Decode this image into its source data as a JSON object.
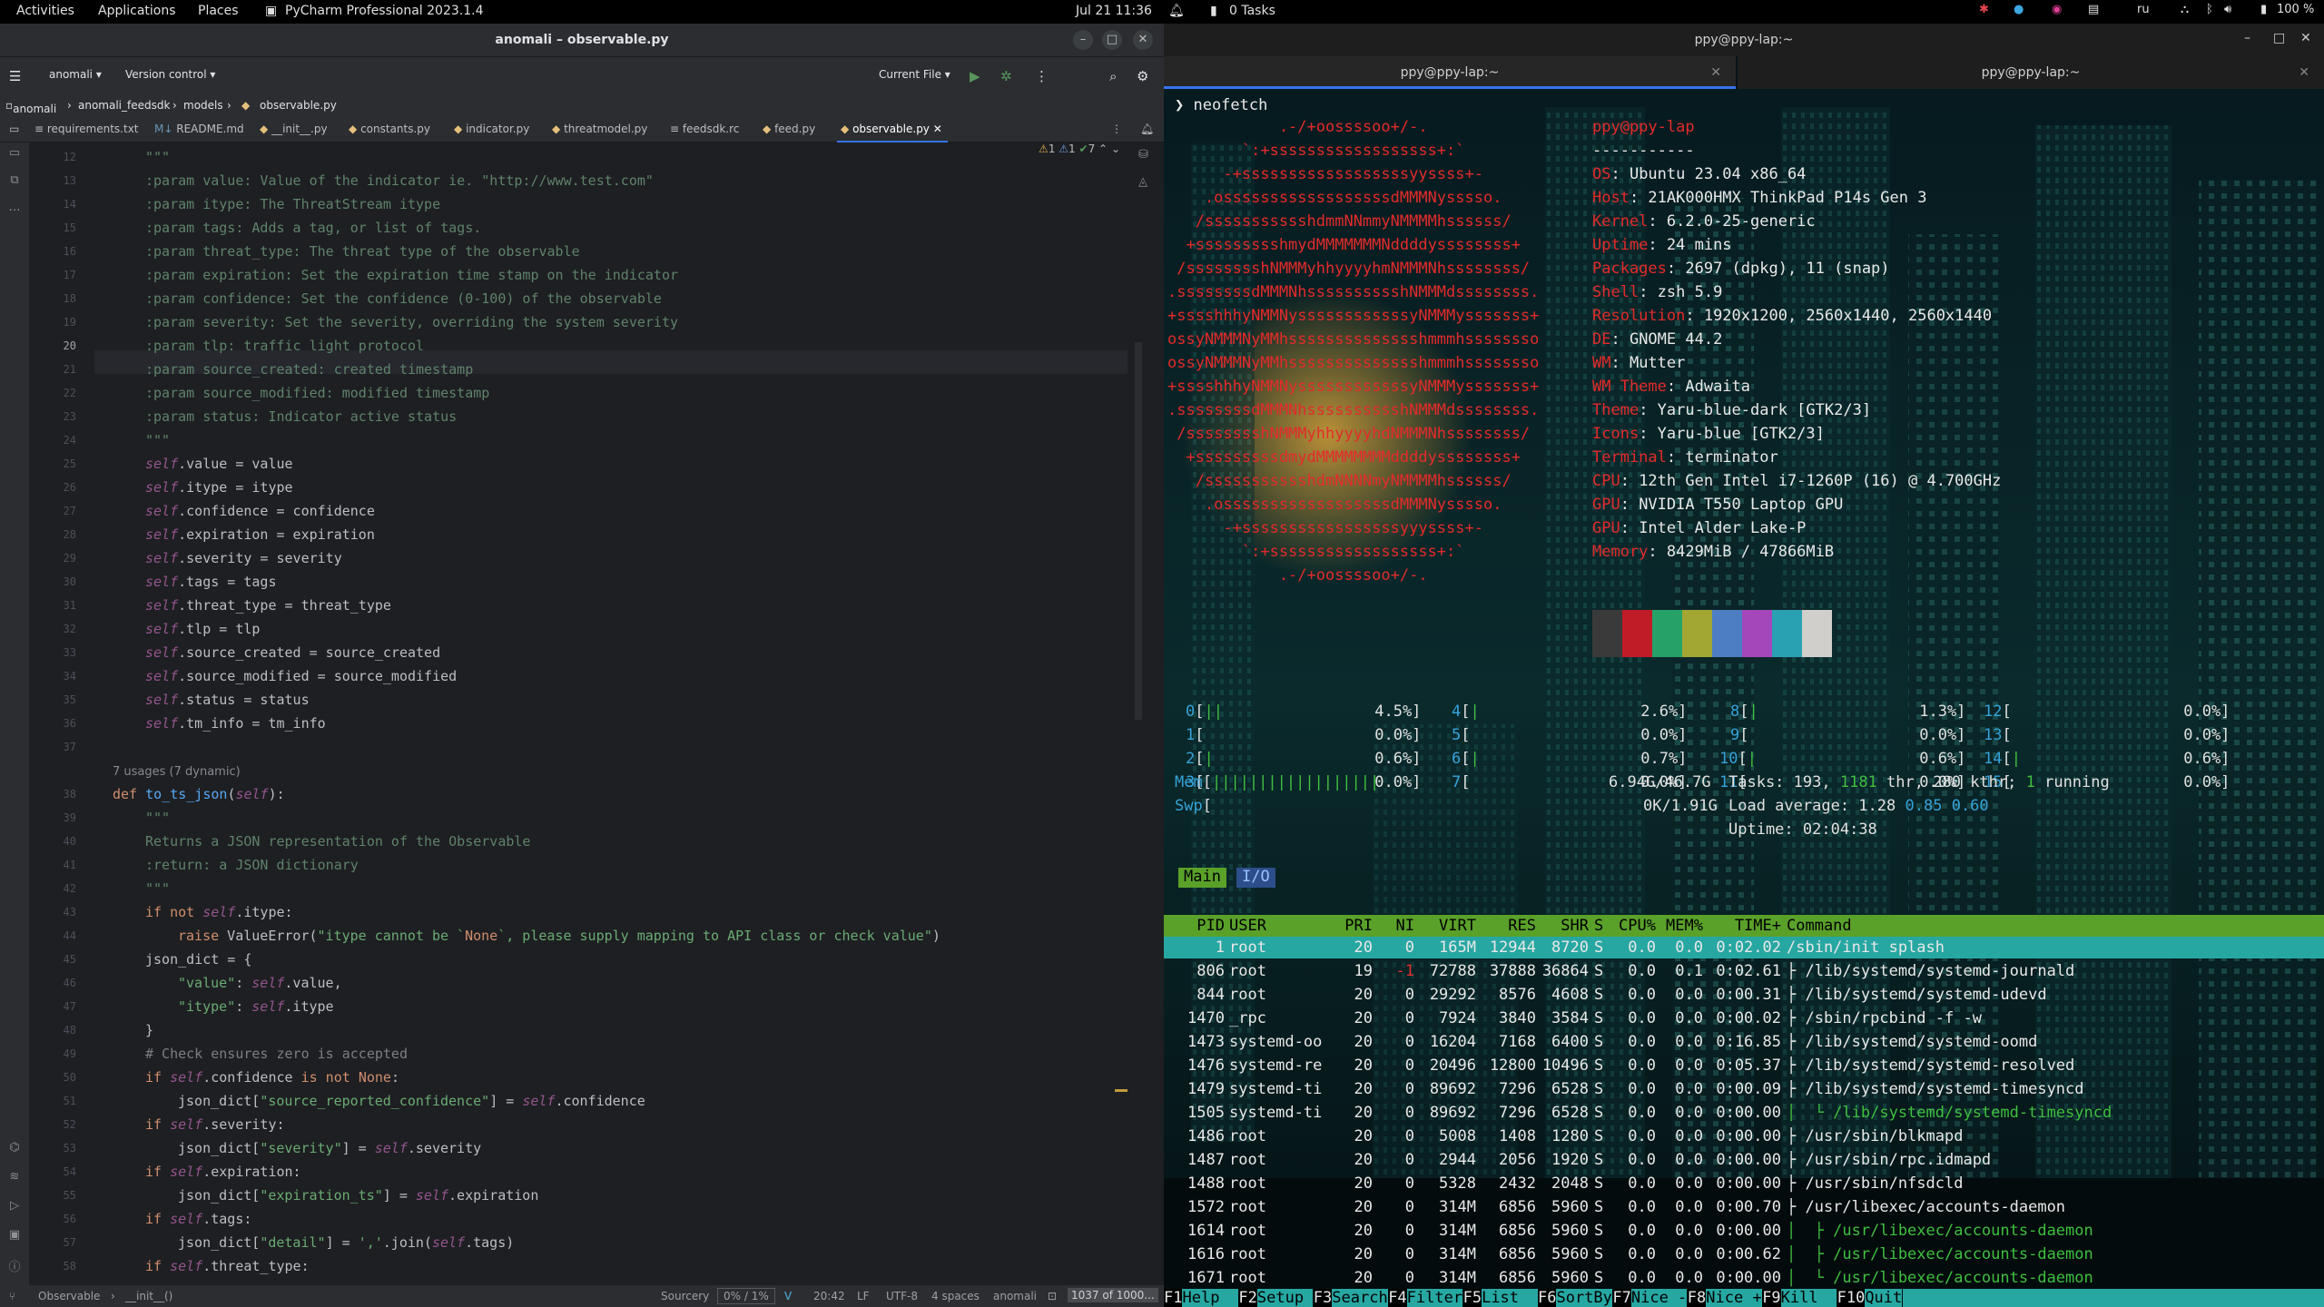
{
  "topbar": {
    "activities": "Activities",
    "applications": "Applications",
    "places": "Places",
    "window_app": "PyCharm Professional 2023.1.4",
    "datetime": "Jul 21  11:36",
    "tasks": "0 Tasks",
    "lang": "ru",
    "battery": "100 %"
  },
  "ide": {
    "title": "anomali – observable.py",
    "project": "anomali",
    "vcs": "Version control",
    "run_config": "Current File",
    "breadcrumb": [
      "anomali",
      "anomali_feedsdk",
      "models",
      "observable.py"
    ],
    "tabs": [
      "requirements.txt",
      "README.md",
      "__init__.py",
      "constants.py",
      "indicator.py",
      "threatmodel.py",
      "feedsdk.rc",
      "feed.py",
      "observable.py"
    ],
    "inspections": {
      "warn": "1",
      "weak": "1",
      "ok": "7"
    },
    "line_numbers": [
      "12",
      "13",
      "14",
      "15",
      "16",
      "17",
      "18",
      "19",
      "20",
      "21",
      "22",
      "23",
      "24",
      "25",
      "26",
      "27",
      "28",
      "29",
      "30",
      "31",
      "32",
      "33",
      "34",
      "35",
      "36",
      "37",
      "",
      "38",
      "39",
      "40",
      "41",
      "42",
      "43",
      "44",
      "45",
      "46",
      "47",
      "48",
      "49",
      "50",
      "51",
      "52",
      "53",
      "54",
      "55",
      "56",
      "57",
      "58"
    ],
    "current_line": "20",
    "code": [
      "\"\"\"",
      ":param value: Value of the indicator ie. \"http://www.test.com\"",
      ":param itype: The ThreatStream itype",
      ":param tags: Adds a tag, or list of tags.",
      ":param threat_type: The threat type of the observable",
      ":param expiration: Set the expiration time stamp on the indicator",
      ":param confidence: Set the confidence (0-100) of the observable",
      ":param severity: Set the severity, overriding the system severity",
      ":param tlp: traffic light protocol",
      ":param source_created: created timestamp",
      ":param source_modified: modified timestamp",
      ":param status: Indicator active status",
      "\"\"\"",
      "self.value = value",
      "self.itype = itype",
      "self.confidence = confidence",
      "self.expiration = expiration",
      "self.severity = severity",
      "self.tags = tags",
      "self.threat_type = threat_type",
      "self.tlp = tlp",
      "self.source_created = source_created",
      "self.source_modified = source_modified",
      "self.status = status",
      "self.tm_info = tm_info",
      "",
      "7 usages (7 dynamic)",
      "def to_ts_json(self):",
      "\"\"\"",
      "Returns a JSON representation of the Observable",
      ":return: a JSON dictionary",
      "\"\"\"",
      "if not self.itype:",
      "raise ValueError(\"itype cannot be `None`, please supply mapping to API class or check value\")",
      "json_dict = {",
      "\"value\": self.value,",
      "\"itype\": self.itype",
      "}",
      "# Check ensures zero is accepted",
      "if self.confidence is not None:",
      "json_dict[\"source_reported_confidence\"] = self.confidence",
      "if self.severity:",
      "json_dict[\"severity\"] = self.severity",
      "if self.expiration:",
      "json_dict[\"expiration_ts\"] = self.expiration",
      "if self.tags:",
      "json_dict[\"detail\"] = ','.join(self.tags)",
      "if self.threat_type:"
    ],
    "status": {
      "crumb1": "Observable",
      "crumb2": "__init__()",
      "plugin": "Sourcery",
      "progress": "0% / 1%",
      "pos": "20:42",
      "eol": "LF",
      "enc": "UTF-8",
      "indent": "4 spaces",
      "interp": "anomali",
      "mem": "1037 of 1000..."
    }
  },
  "terminal": {
    "title": "ppy@ppy-lap:~",
    "tab1": "ppy@ppy-lap:~",
    "tab2": "ppy@ppy-lap:~",
    "prompt": "❯ neofetch",
    "logo": [
      "            .-/+oossssoo+/-.",
      "        `:+ssssssssssssssssss+:`",
      "      -+ssssssssssssssssssyyssss+-",
      "    .ossssssssssssssssssdMMMNysssso.",
      "   /ssssssssssshdmmNNmmyNMMMMhssssss/",
      "  +ssssssssshmydMMMMMMMNddddyssssssss+",
      " /sssssssshNMMMyhhyyyyhmNMMMNhssssssss/",
      ".ssssssssdMMMNhsssssssssshNMMMdssssssss.",
      "+sssshhhyNMMNyssssssssssssyNMMMysssssss+",
      "ossyNMMMNyMMhsssssssssssssshmmmhssssssso",
      "ossyNMMMNyMMhsssssssssssssshmmmhssssssso",
      "+sssshhhyNMMNyssssssssssssyNMMMysssssss+",
      ".ssssssssdMMMNhsssssssssshNMMMdssssssss.",
      " /sssssssshNMMMyhhyyyyhdNMMMNhssssssss/",
      "  +sssssssssdmydMMMMMMMMddddyssssssss+",
      "   /ssssssssssshdmNNNNmyNMMMMhssssss/",
      "    .ossssssssssssssssssdMMMNysssso.",
      "      -+sssssssssssssssssyyyssss+-",
      "        `:+ssssssssssssssssss+:`",
      "            .-/+oossssoo+/-."
    ],
    "userhost": "ppy@ppy-lap",
    "separator": "-----------",
    "info": [
      {
        "k": "OS",
        "v": "Ubuntu 23.04 x86_64"
      },
      {
        "k": "Host",
        "v": "21AK000HMX ThinkPad P14s Gen 3"
      },
      {
        "k": "Kernel",
        "v": "6.2.0-25-generic"
      },
      {
        "k": "Uptime",
        "v": "24 mins"
      },
      {
        "k": "Packages",
        "v": "2697 (dpkg), 11 (snap)"
      },
      {
        "k": "Shell",
        "v": "zsh 5.9"
      },
      {
        "k": "Resolution",
        "v": "1920x1200, 2560x1440, 2560x1440"
      },
      {
        "k": "DE",
        "v": "GNOME 44.2"
      },
      {
        "k": "WM",
        "v": "Mutter"
      },
      {
        "k": "WM Theme",
        "v": "Adwaita"
      },
      {
        "k": "Theme",
        "v": "Yaru-blue-dark [GTK2/3]"
      },
      {
        "k": "Icons",
        "v": "Yaru-blue [GTK2/3]"
      },
      {
        "k": "Terminal",
        "v": "terminator"
      },
      {
        "k": "CPU",
        "v": "12th Gen Intel i7-1260P (16) @ 4.700GHz"
      },
      {
        "k": "GPU",
        "v": "NVIDIA T550 Laptop GPU"
      },
      {
        "k": "GPU",
        "v": "Intel Alder Lake-P"
      },
      {
        "k": "Memory",
        "v": "8429MiB / 47866MiB"
      }
    ],
    "swatches": [
      "#3a3a3a",
      "#c01c28",
      "#26a269",
      "#a2a734",
      "#4d7ec4",
      "#a347ba",
      "#2aa1b3",
      "#d0cfcc"
    ],
    "cpus": [
      {
        "n": "0",
        "bar": "||",
        "pct": "4.5%"
      },
      {
        "n": "1",
        "bar": "",
        "pct": "0.0%"
      },
      {
        "n": "2",
        "bar": "|",
        "pct": "0.6%"
      },
      {
        "n": "3",
        "bar": "",
        "pct": "0.0%"
      },
      {
        "n": "4",
        "bar": "|",
        "pct": "2.6%"
      },
      {
        "n": "5",
        "bar": "",
        "pct": "0.0%"
      },
      {
        "n": "6",
        "bar": "|",
        "pct": "0.7%"
      },
      {
        "n": "7",
        "bar": "",
        "pct": "0.0%"
      },
      {
        "n": "8",
        "bar": "|",
        "pct": "1.3%"
      },
      {
        "n": "9",
        "bar": "",
        "pct": "0.0%"
      },
      {
        "n": "10",
        "bar": "|",
        "pct": "0.6%"
      },
      {
        "n": "11",
        "bar": "",
        "pct": "0.0%"
      },
      {
        "n": "12",
        "bar": "",
        "pct": "0.0%"
      },
      {
        "n": "13",
        "bar": "",
        "pct": "0.0%"
      },
      {
        "n": "14",
        "bar": "|",
        "pct": "0.6%"
      },
      {
        "n": "15",
        "bar": "",
        "pct": "0.0%"
      }
    ],
    "mem_label": "Mem",
    "mem_bar": "||||||||||||||||||",
    "mem_value": "6.94G/46.7G",
    "swp_label": "Swp",
    "swp_value": "0K/1.91G",
    "tasks": "193",
    "thr": "1181",
    "kthr": "280",
    "running": "1",
    "load1": "1.28",
    "load5": "0.85",
    "load15": "0.60",
    "uptime": "02:04:38",
    "htop_tabs": [
      "Main",
      "I/O"
    ],
    "headers": {
      "pid": "PID",
      "user": "USER",
      "pri": "PRI",
      "ni": "NI",
      "virt": "VIRT",
      "res": "RES",
      "shr": "SHR",
      "s": "S",
      "cpu": "CPU%",
      "mem": "MEM%",
      "time": "TIME+",
      "cmd": "Command"
    },
    "processes": [
      {
        "pid": "1",
        "user": "root",
        "pri": "20",
        "ni": "0",
        "virt": "165M",
        "res": "12944",
        "shr": "8720",
        "s": "S",
        "cpu": "0.0",
        "mem": "0.0",
        "time": "0:02.02",
        "cmd": "/sbin/init splash",
        "thread": false
      },
      {
        "pid": "806",
        "user": "root",
        "pri": "19",
        "ni": "-1",
        "virt": "72788",
        "res": "37888",
        "shr": "36864",
        "s": "S",
        "cpu": "0.0",
        "mem": "0.1",
        "time": "0:02.61",
        "cmd": "├ /lib/systemd/systemd-journald",
        "thread": false
      },
      {
        "pid": "844",
        "user": "root",
        "pri": "20",
        "ni": "0",
        "virt": "29292",
        "res": "8576",
        "shr": "4608",
        "s": "S",
        "cpu": "0.0",
        "mem": "0.0",
        "time": "0:00.31",
        "cmd": "├ /lib/systemd/systemd-udevd",
        "thread": false
      },
      {
        "pid": "1470",
        "user": "_rpc",
        "pri": "20",
        "ni": "0",
        "virt": "7924",
        "res": "3840",
        "shr": "3584",
        "s": "S",
        "cpu": "0.0",
        "mem": "0.0",
        "time": "0:00.02",
        "cmd": "├ /sbin/rpcbind -f -w",
        "thread": false
      },
      {
        "pid": "1473",
        "user": "systemd-oo",
        "pri": "20",
        "ni": "0",
        "virt": "16204",
        "res": "7168",
        "shr": "6400",
        "s": "S",
        "cpu": "0.0",
        "mem": "0.0",
        "time": "0:16.85",
        "cmd": "├ /lib/systemd/systemd-oomd",
        "thread": false
      },
      {
        "pid": "1476",
        "user": "systemd-re",
        "pri": "20",
        "ni": "0",
        "virt": "20496",
        "res": "12800",
        "shr": "10496",
        "s": "S",
        "cpu": "0.0",
        "mem": "0.0",
        "time": "0:05.37",
        "cmd": "├ /lib/systemd/systemd-resolved",
        "thread": false
      },
      {
        "pid": "1479",
        "user": "systemd-ti",
        "pri": "20",
        "ni": "0",
        "virt": "89692",
        "res": "7296",
        "shr": "6528",
        "s": "S",
        "cpu": "0.0",
        "mem": "0.0",
        "time": "0:00.09",
        "cmd": "├ /lib/systemd/systemd-timesyncd",
        "thread": false
      },
      {
        "pid": "1505",
        "user": "systemd-ti",
        "pri": "20",
        "ni": "0",
        "virt": "89692",
        "res": "7296",
        "shr": "6528",
        "s": "S",
        "cpu": "0.0",
        "mem": "0.0",
        "time": "0:00.00",
        "cmd": "│  └ /lib/systemd/systemd-timesyncd",
        "thread": true
      },
      {
        "pid": "1486",
        "user": "root",
        "pri": "20",
        "ni": "0",
        "virt": "5008",
        "res": "1408",
        "shr": "1280",
        "s": "S",
        "cpu": "0.0",
        "mem": "0.0",
        "time": "0:00.00",
        "cmd": "├ /usr/sbin/blkmapd",
        "thread": false
      },
      {
        "pid": "1487",
        "user": "root",
        "pri": "20",
        "ni": "0",
        "virt": "2944",
        "res": "2056",
        "shr": "1920",
        "s": "S",
        "cpu": "0.0",
        "mem": "0.0",
        "time": "0:00.00",
        "cmd": "├ /usr/sbin/rpc.idmapd",
        "thread": false
      },
      {
        "pid": "1488",
        "user": "root",
        "pri": "20",
        "ni": "0",
        "virt": "5328",
        "res": "2432",
        "shr": "2048",
        "s": "S",
        "cpu": "0.0",
        "mem": "0.0",
        "time": "0:00.00",
        "cmd": "├ /usr/sbin/nfsdcld",
        "thread": false
      },
      {
        "pid": "1572",
        "user": "root",
        "pri": "20",
        "ni": "0",
        "virt": "314M",
        "res": "6856",
        "shr": "5960",
        "s": "S",
        "cpu": "0.0",
        "mem": "0.0",
        "time": "0:00.70",
        "cmd": "├ /usr/libexec/accounts-daemon",
        "thread": false
      },
      {
        "pid": "1614",
        "user": "root",
        "pri": "20",
        "ni": "0",
        "virt": "314M",
        "res": "6856",
        "shr": "5960",
        "s": "S",
        "cpu": "0.0",
        "mem": "0.0",
        "time": "0:00.00",
        "cmd": "│  ├ /usr/libexec/accounts-daemon",
        "thread": true
      },
      {
        "pid": "1616",
        "user": "root",
        "pri": "20",
        "ni": "0",
        "virt": "314M",
        "res": "6856",
        "shr": "5960",
        "s": "S",
        "cpu": "0.0",
        "mem": "0.0",
        "time": "0:00.62",
        "cmd": "│  ├ /usr/libexec/accounts-daemon",
        "thread": true
      },
      {
        "pid": "1671",
        "user": "root",
        "pri": "20",
        "ni": "0",
        "virt": "314M",
        "res": "6856",
        "shr": "5960",
        "s": "S",
        "cpu": "0.0",
        "mem": "0.0",
        "time": "0:00.00",
        "cmd": "│  └ /usr/libexec/accounts-daemon",
        "thread": true
      }
    ],
    "fkeys": [
      {
        "k": "F1",
        "l": "Help  "
      },
      {
        "k": "F2",
        "l": "Setup "
      },
      {
        "k": "F3",
        "l": "Search"
      },
      {
        "k": "F4",
        "l": "Filter"
      },
      {
        "k": "F5",
        "l": "List  "
      },
      {
        "k": "F6",
        "l": "SortBy"
      },
      {
        "k": "F7",
        "l": "Nice -"
      },
      {
        "k": "F8",
        "l": "Nice +"
      },
      {
        "k": "F9",
        "l": "Kill  "
      },
      {
        "k": "F10",
        "l": "Quit"
      }
    ]
  }
}
